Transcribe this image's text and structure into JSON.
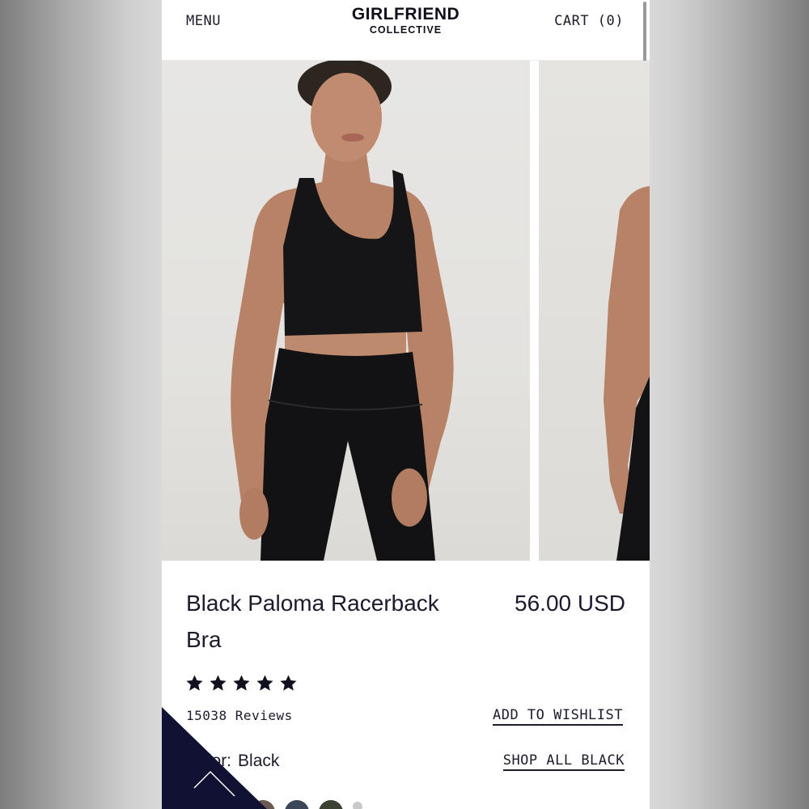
{
  "header": {
    "menu_label": "MENU",
    "logo_line1": "GIRLFRIEND",
    "logo_line2": "COLLECTIVE",
    "cart_label": "CART (0)"
  },
  "gallery": {
    "images": [
      {
        "alt": "model-front"
      },
      {
        "alt": "model-back"
      }
    ]
  },
  "product": {
    "title": "Black Paloma Racerback Bra",
    "price": "56.00 USD",
    "rating": 5,
    "reviews": "15038 Reviews",
    "color_label": "Color:",
    "color_value": "Black",
    "wishlist_label": "ADD TO WISHLIST",
    "shop_all_label": "SHOP ALL BLACK"
  },
  "colors": {
    "accent": "#10101f",
    "text": "#1b1b2b",
    "badge": "#111133",
    "swatches": [
      "#6a5a52",
      "#3b4659",
      "#3c4335",
      "#c9c9c9"
    ]
  }
}
